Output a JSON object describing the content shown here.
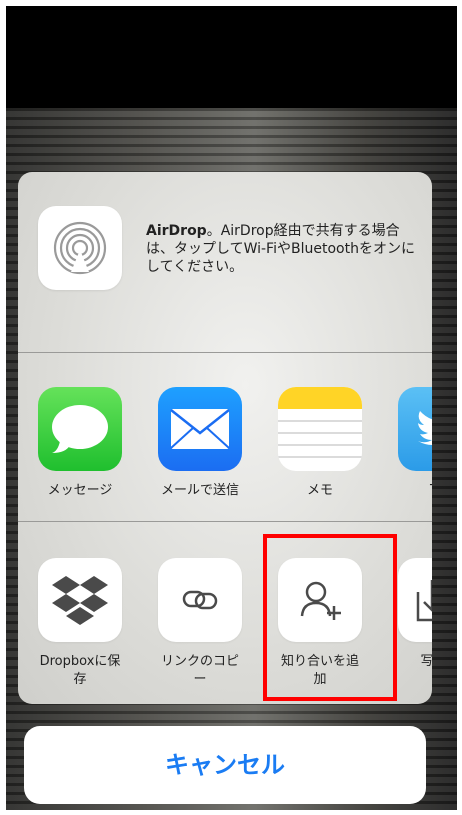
{
  "airdrop": {
    "title": "AirDrop",
    "description": "。AirDrop経由で共有する場合は、タップしてWi-FiやBluetoothをオンにしてください。",
    "icon": "airdrop-icon"
  },
  "apps": [
    {
      "label": "メッセージ",
      "icon": "messages-icon"
    },
    {
      "label": "メールで送信",
      "icon": "mail-icon"
    },
    {
      "label": "メモ",
      "icon": "notes-icon"
    },
    {
      "label": "Twi",
      "icon": "twitter-icon"
    }
  ],
  "actions": [
    {
      "label": "Dropboxに保\n存",
      "icon": "dropbox-icon"
    },
    {
      "label": "リンクのコピ\nー",
      "icon": "link-icon"
    },
    {
      "label": "知り合いを追\n加",
      "icon": "add-contact-icon"
    },
    {
      "label": "写真の",
      "icon": "save-image-icon"
    }
  ],
  "cancel_label": "キャンセル",
  "colors": {
    "accent": "#1a7cf3",
    "highlight": "#ff0000"
  }
}
